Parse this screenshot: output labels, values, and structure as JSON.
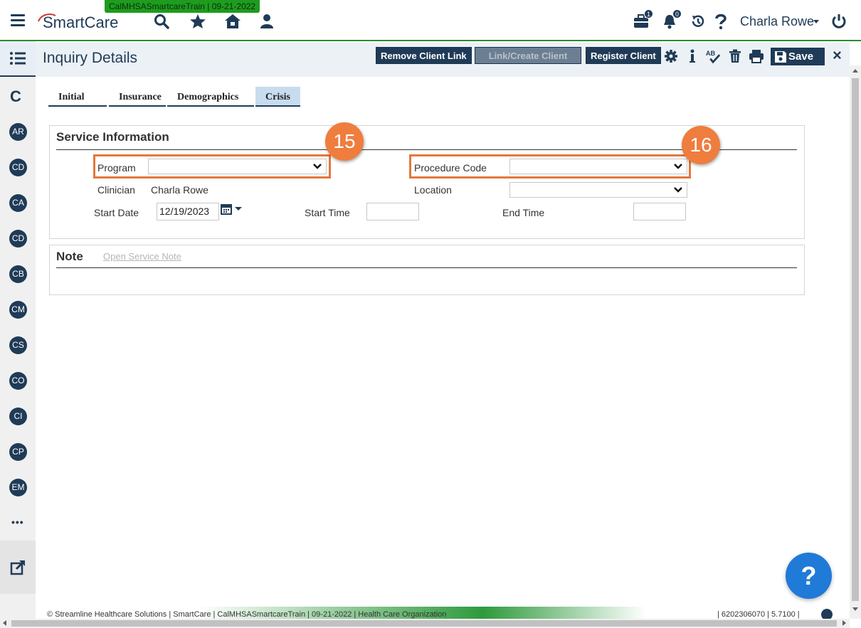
{
  "header": {
    "env_badge": "CalMHSASmartcareTrain | 09-21-2022",
    "logo_text": "SmartCare",
    "briefcase_count": "1",
    "alerts_count": "0",
    "user_name": "Charla Rowe"
  },
  "sidebar": {
    "c_label": "C",
    "items": [
      "AR",
      "CD",
      "CA",
      "CD",
      "CB",
      "CM",
      "CS",
      "CO",
      "CI",
      "CP",
      "EM"
    ],
    "more": "•••"
  },
  "toolbar": {
    "page_title": "Inquiry Details",
    "remove_client_link": "Remove Client Link",
    "link_create_client": "Link/Create Client",
    "register_client": "Register Client",
    "save_label": "Save",
    "close_label": "×"
  },
  "tabs": {
    "initial": "Initial",
    "insurance": "Insurance",
    "demographics": "Demographics",
    "crisis": "Crisis"
  },
  "service_info": {
    "title": "Service Information",
    "program_label": "Program",
    "program_value": "",
    "procedure_label": "Procedure Code",
    "procedure_value": "",
    "clinician_label": "Clinician",
    "clinician_value": "Charla Rowe",
    "location_label": "Location",
    "location_value": "",
    "start_date_label": "Start Date",
    "start_date_value": "12/19/2023",
    "start_time_label": "Start Time",
    "start_time_value": "",
    "end_time_label": "End Time",
    "end_time_value": ""
  },
  "callouts": {
    "program_step": "15",
    "procedure_step": "16"
  },
  "note": {
    "title": "Note",
    "open_link": "Open Service Note"
  },
  "footer": {
    "left_text": "© Streamline Healthcare Solutions | SmartCare | CalMHSASmartcareTrain | 09-21-2022 | Health Care Organization",
    "right_text": "| 6202306070 | 5.7100 |"
  },
  "help_fab": "?",
  "colors": {
    "brand_navy": "#1f3b57",
    "accent_green": "#2e8b2e",
    "callout_orange": "#ef7d3e",
    "help_blue": "#1f7ad8"
  },
  "icons": {
    "header": [
      "hamburger-icon",
      "search-icon",
      "star-icon",
      "home-icon",
      "user-icon",
      "briefcase-icon",
      "bell-icon",
      "history-icon",
      "question-icon",
      "power-icon"
    ],
    "toolbar": [
      "gear-icon",
      "info-icon",
      "spellcheck-icon",
      "trash-icon",
      "print-icon",
      "save-icon"
    ]
  }
}
